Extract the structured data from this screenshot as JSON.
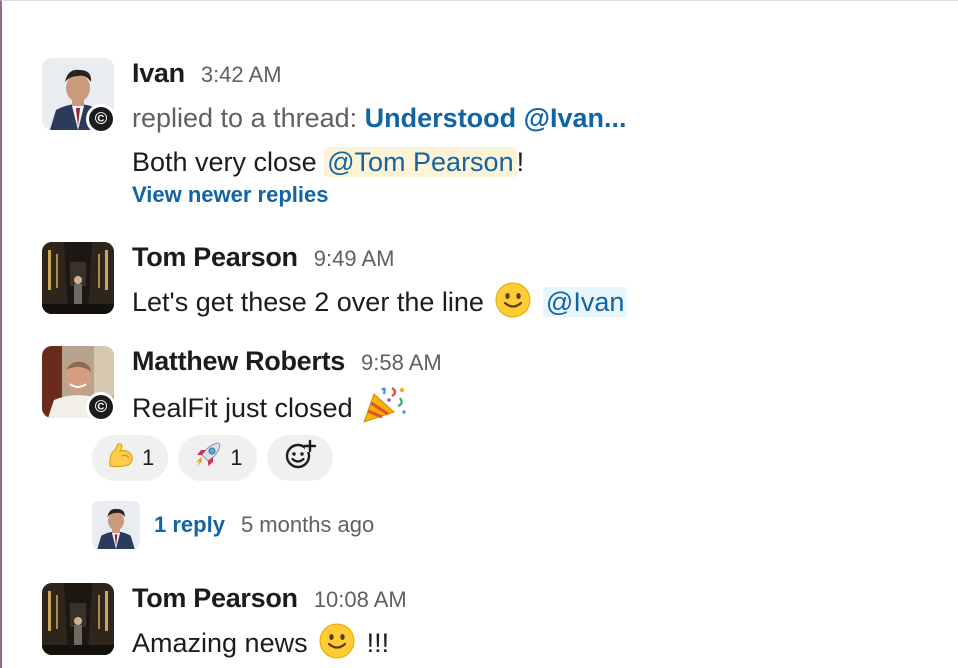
{
  "messages": [
    {
      "sender": "Ivan",
      "time": "3:42 AM",
      "thread_prefix": "replied to a thread:",
      "thread_title": "Understood @Ivan...",
      "text_before": "Both very close",
      "mention": "@Tom Pearson",
      "text_after": "!",
      "view_newer": "View newer replies",
      "badge_icon": "copyright-badge-icon"
    },
    {
      "sender": "Tom Pearson",
      "time": "9:49 AM",
      "text_before": "Let's get these 2 over the line",
      "emoji": "slightly-smiling-face-icon",
      "mention": "@Ivan"
    },
    {
      "sender": "Matthew Roberts",
      "time": "9:58 AM",
      "text_before": "RealFit just closed",
      "emoji": "party-popper-icon",
      "badge_icon": "copyright-badge-icon",
      "reactions": [
        {
          "emoji": "flexed-biceps-icon",
          "count": "1"
        },
        {
          "emoji": "rocket-icon",
          "count": "1"
        }
      ],
      "add_reaction_icon": "add-reaction-icon",
      "thread_replies": "1 reply",
      "thread_time": "5 months ago"
    },
    {
      "sender": "Tom Pearson",
      "time": "10:08 AM",
      "text_before": "Amazing news",
      "emoji": "slightly-smiling-face-icon",
      "text_after": "!!!"
    }
  ],
  "colors": {
    "link": "#1264a3",
    "mention_highlight": "#fdf3d7",
    "mention_blue_bg": "#e8f5fa",
    "muted": "#616061",
    "sidebar_edge": "#8a6d8d"
  }
}
